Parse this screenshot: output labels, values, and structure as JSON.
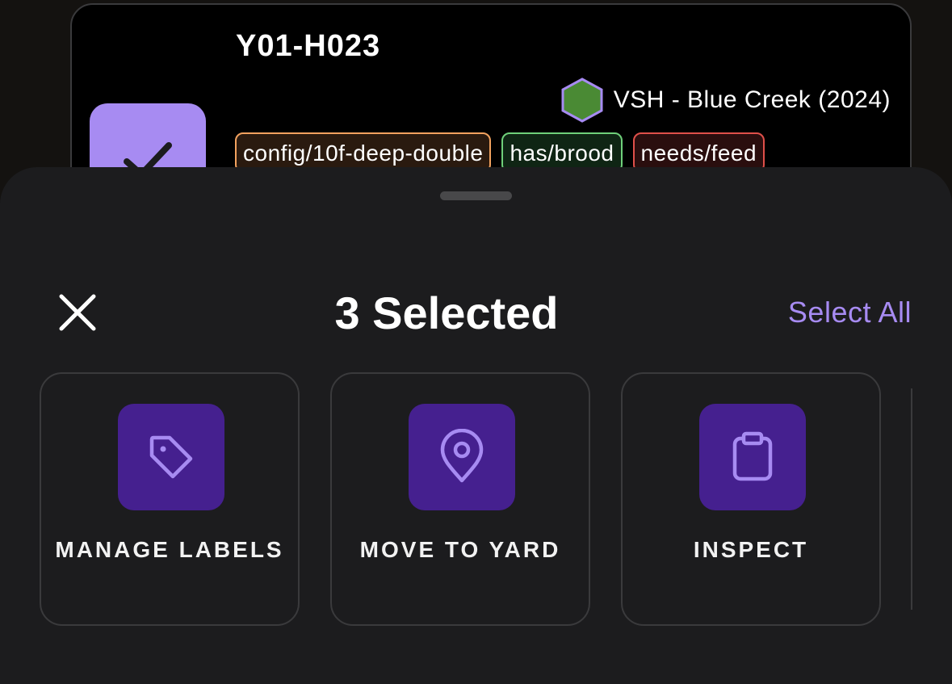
{
  "hive_card": {
    "title": "Y01-H023",
    "breed_label": "VSH - Blue Creek (2024)",
    "tags": [
      {
        "label": "config/10f-deep-double",
        "color": "#f2a25f"
      },
      {
        "label": "has/brood",
        "color": "#6fd07a"
      },
      {
        "label": "needs/feed",
        "color": "#e0504a"
      }
    ],
    "selected": true
  },
  "sheet": {
    "title": "3 Selected",
    "select_all_label": "Select All",
    "actions": [
      {
        "label": "MANAGE LABELS",
        "icon": "tag-icon"
      },
      {
        "label": "MOVE TO YARD",
        "icon": "map-pin-icon"
      },
      {
        "label": "INSPECT",
        "icon": "clipboard-icon"
      }
    ]
  },
  "colors": {
    "accent": "#a78bf2",
    "action_tile": "#45208f",
    "sheet_bg": "#1c1c1e",
    "breed_hex_fill": "#4a8a34"
  }
}
